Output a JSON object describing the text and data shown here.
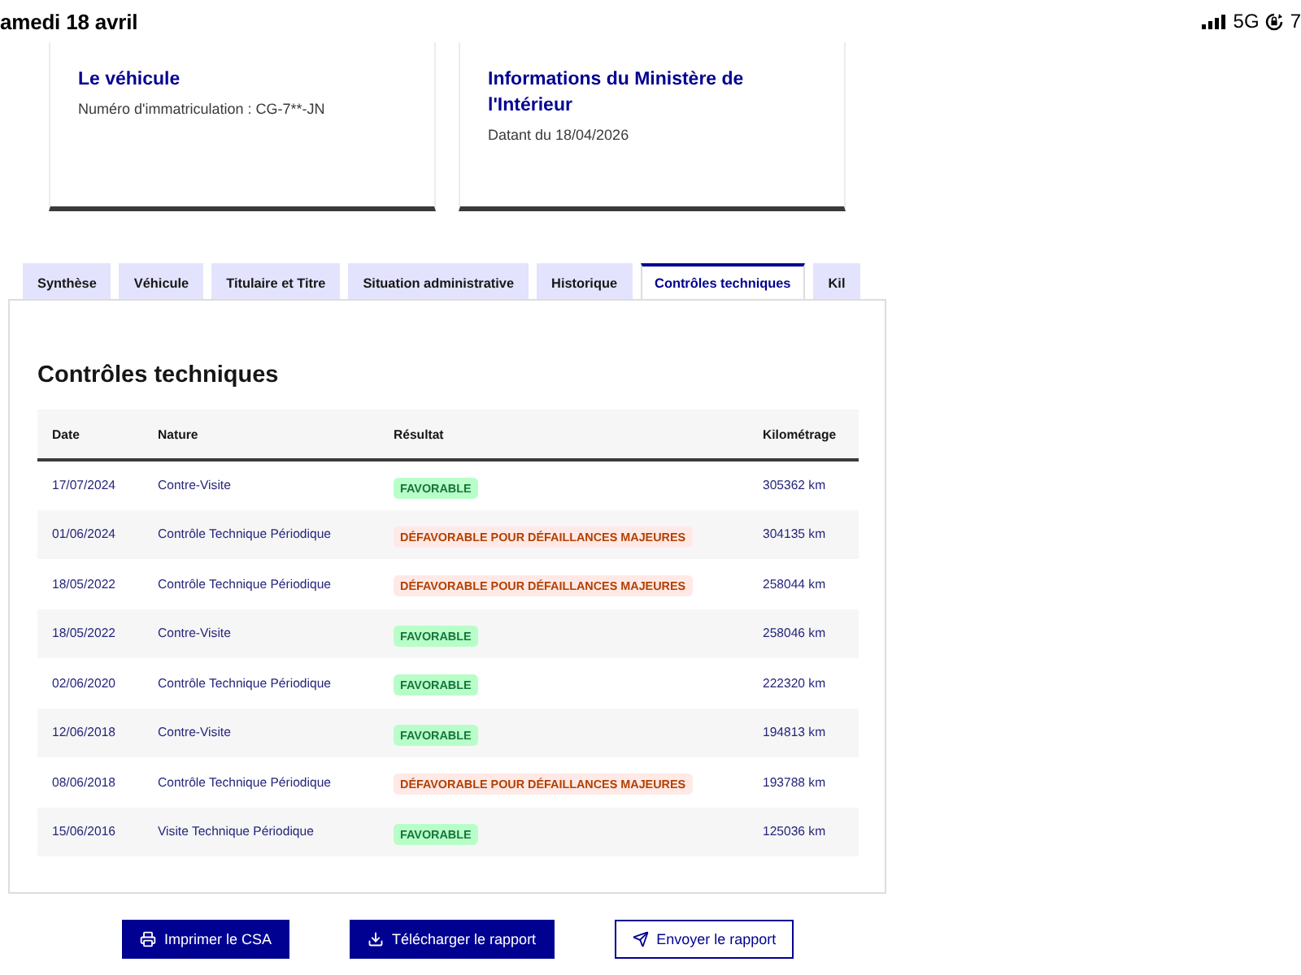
{
  "status_bar": {
    "date": "amedi 18 avril",
    "network": "5G",
    "battery": "7"
  },
  "cards": [
    {
      "title": "Le véhicule",
      "subtitle": "Numéro d'immatriculation : CG-7**-JN"
    },
    {
      "title": "Informations du Ministère de l'Intérieur",
      "subtitle": "Datant du 18/04/2026"
    }
  ],
  "tabs": [
    {
      "label": "Synthèse",
      "selected": false
    },
    {
      "label": "Véhicule",
      "selected": false
    },
    {
      "label": "Titulaire et Titre",
      "selected": false
    },
    {
      "label": "Situation administrative",
      "selected": false
    },
    {
      "label": "Historique",
      "selected": false
    },
    {
      "label": "Contrôles techniques",
      "selected": true
    },
    {
      "label": "Kil",
      "selected": false
    }
  ],
  "panel": {
    "title": "Contrôles techniques",
    "table": {
      "columns": [
        "Date",
        "Nature",
        "Résultat",
        "Kilométrage"
      ],
      "rows": [
        {
          "date": "17/07/2024",
          "nature": "Contre-Visite",
          "result": {
            "label": "FAVORABLE",
            "kind": "favorable"
          },
          "mileage": "305362 km"
        },
        {
          "date": "01/06/2024",
          "nature": "Contrôle Technique Périodique",
          "result": {
            "label": "DÉFAVORABLE POUR DÉFAILLANCES MAJEURES",
            "kind": "unfavorable"
          },
          "mileage": "304135 km"
        },
        {
          "date": "18/05/2022",
          "nature": "Contrôle Technique Périodique",
          "result": {
            "label": "DÉFAVORABLE POUR DÉFAILLANCES MAJEURES",
            "kind": "unfavorable"
          },
          "mileage": "258044 km"
        },
        {
          "date": "18/05/2022",
          "nature": "Contre-Visite",
          "result": {
            "label": "FAVORABLE",
            "kind": "favorable"
          },
          "mileage": "258046 km"
        },
        {
          "date": "02/06/2020",
          "nature": "Contrôle Technique Périodique",
          "result": {
            "label": "FAVORABLE",
            "kind": "favorable"
          },
          "mileage": "222320 km"
        },
        {
          "date": "12/06/2018",
          "nature": "Contre-Visite",
          "result": {
            "label": "FAVORABLE",
            "kind": "favorable"
          },
          "mileage": "194813 km"
        },
        {
          "date": "08/06/2018",
          "nature": "Contrôle Technique Périodique",
          "result": {
            "label": "DÉFAVORABLE POUR DÉFAILLANCES MAJEURES",
            "kind": "unfavorable"
          },
          "mileage": "193788 km"
        },
        {
          "date": "15/06/2016",
          "nature": "Visite Technique Périodique",
          "result": {
            "label": "FAVORABLE",
            "kind": "favorable"
          },
          "mileage": "125036 km"
        }
      ]
    }
  },
  "buttons": [
    {
      "label": "Imprimer le CSA",
      "kind": "primary"
    },
    {
      "label": "Télécharger le rapport",
      "kind": "primary"
    },
    {
      "label": "Envoyer le rapport",
      "kind": "secondary"
    }
  ]
}
